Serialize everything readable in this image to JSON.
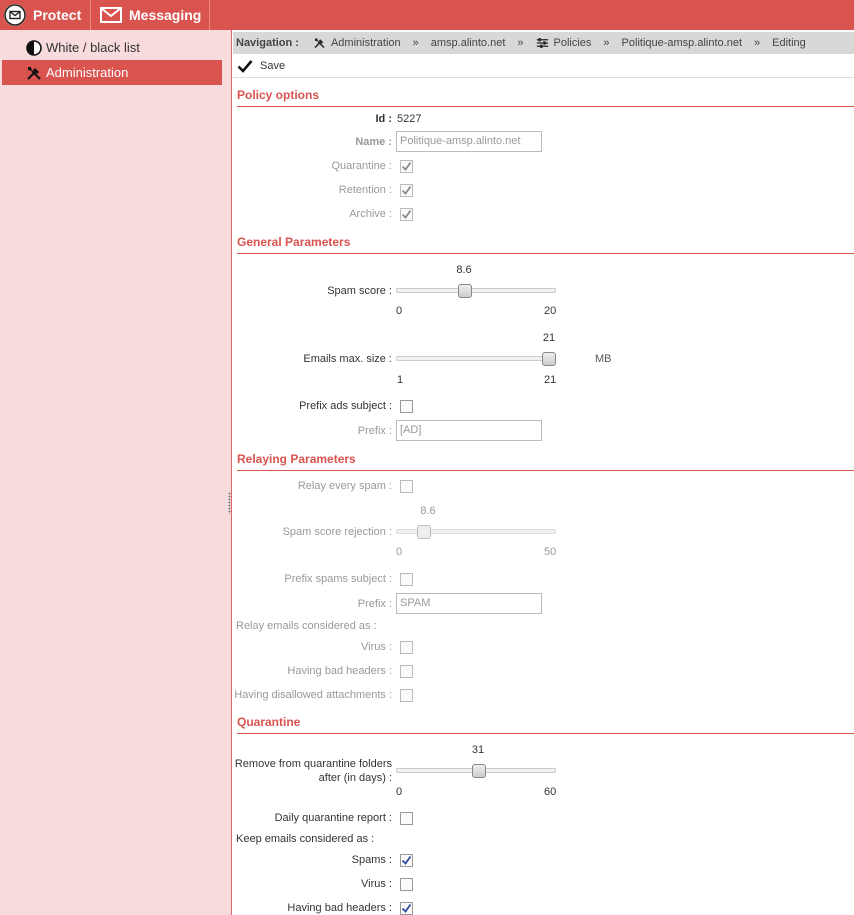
{
  "tabs": {
    "protect": "Protect",
    "messaging": "Messaging"
  },
  "sidebar": {
    "items": [
      {
        "label": "White / black list",
        "icon": "half-circle-icon"
      },
      {
        "label": "Administration",
        "icon": "tools-icon"
      }
    ]
  },
  "navigation": {
    "label": "Navigation :",
    "crumbs": [
      "Administration",
      "amsp.alinto.net",
      "Policies",
      "Politique-amsp.alinto.net",
      "Editing"
    ],
    "separator": "»"
  },
  "toolbar": {
    "save": "Save"
  },
  "policy_options": {
    "title": "Policy options",
    "id_label": "Id :",
    "id_value": "5227",
    "name_label": "Name :",
    "name_value": "Politique-amsp.alinto.net",
    "quarantine_label": "Quarantine :",
    "quarantine_checked": true,
    "retention_label": "Retention :",
    "retention_checked": true,
    "archive_label": "Archive :",
    "archive_checked": true
  },
  "general": {
    "title": "General Parameters",
    "spam_score_label": "Spam score :",
    "spam_score": {
      "value": "8.6",
      "min": "0",
      "max": "20"
    },
    "max_size_label": "Emails max. size  :",
    "max_size": {
      "value": "21",
      "min": "1",
      "max": "21",
      "unit": "MB"
    },
    "prefix_ads_label": "Prefix ads subject :",
    "prefix_ads_checked": false,
    "prefix_label": "Prefix :",
    "prefix_value": "[AD]"
  },
  "relaying": {
    "title": "Relaying Parameters",
    "relay_every_label": "Relay every spam :",
    "relay_every_checked": false,
    "rejection_label": "Spam score rejection :",
    "rejection": {
      "value": "8.6",
      "min": "0",
      "max": "50"
    },
    "prefix_spams_label": "Prefix spams subject :",
    "prefix_spams_checked": false,
    "prefix_label": "Prefix :",
    "prefix_value": "SPAM",
    "considered_label": "Relay emails considered as :",
    "virus_label": "Virus :",
    "virus_checked": false,
    "bad_headers_label": "Having bad headers :",
    "bad_headers_checked": false,
    "disallowed_label": "Having disallowed attachments :",
    "disallowed_checked": false
  },
  "quarantine": {
    "title": "Quarantine",
    "remove_label_1": "Remove from quarantine folders",
    "remove_label_2": "after (in days) :",
    "remove": {
      "value": "31",
      "min": "0",
      "max": "60"
    },
    "daily_report_label": "Daily quarantine report :",
    "daily_report_checked": false,
    "keep_label": "Keep emails considered as :",
    "spams_label": "Spams :",
    "spams_checked": true,
    "virus_label": "Virus :",
    "virus_checked": false,
    "bad_headers_label": "Having bad headers :",
    "bad_headers_checked": true
  },
  "colors": {
    "accent": "#d9534f",
    "sidebar_bg": "#f8dbdc",
    "nav_bg": "#d8d8d8",
    "check_blue": "#2a4d9c"
  }
}
